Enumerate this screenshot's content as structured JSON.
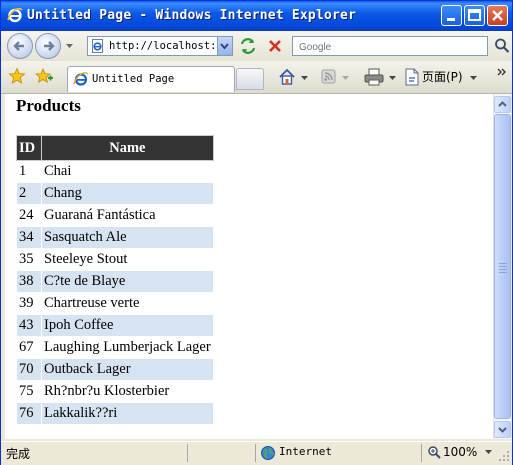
{
  "window": {
    "title": "Untitled Page - Windows Internet Explorer",
    "icon": "ie-logo-icon",
    "controls": [
      "minimize-icon",
      "maximize-icon",
      "close-icon"
    ]
  },
  "address_bar": {
    "url": "http://localhost::",
    "search_placeholder": "Google"
  },
  "tab_bar": {
    "tab_label": "Untitled Page",
    "page_menu_label": "页面(P)"
  },
  "page": {
    "heading": "Products",
    "table": {
      "columns": [
        "ID",
        "Name"
      ],
      "rows": [
        {
          "id": "1",
          "name": "Chai"
        },
        {
          "id": "2",
          "name": "Chang"
        },
        {
          "id": "24",
          "name": "Guaraná Fantástica"
        },
        {
          "id": "34",
          "name": "Sasquatch Ale"
        },
        {
          "id": "35",
          "name": "Steeleye Stout"
        },
        {
          "id": "38",
          "name": "C?te de Blaye"
        },
        {
          "id": "39",
          "name": "Chartreuse verte"
        },
        {
          "id": "43",
          "name": "Ipoh Coffee"
        },
        {
          "id": "67",
          "name": "Laughing Lumberjack Lager"
        },
        {
          "id": "70",
          "name": "Outback Lager"
        },
        {
          "id": "75",
          "name": "Rh?nbr?u Klosterbier"
        },
        {
          "id": "76",
          "name": "Lakkalik??ri"
        }
      ]
    }
  },
  "status_bar": {
    "status": "完成",
    "zone": "Internet",
    "zoom": "100%"
  },
  "colors": {
    "title_bar": "#0d5ae6",
    "header_row": "#333333",
    "alt_row": "#d6e3f1"
  }
}
